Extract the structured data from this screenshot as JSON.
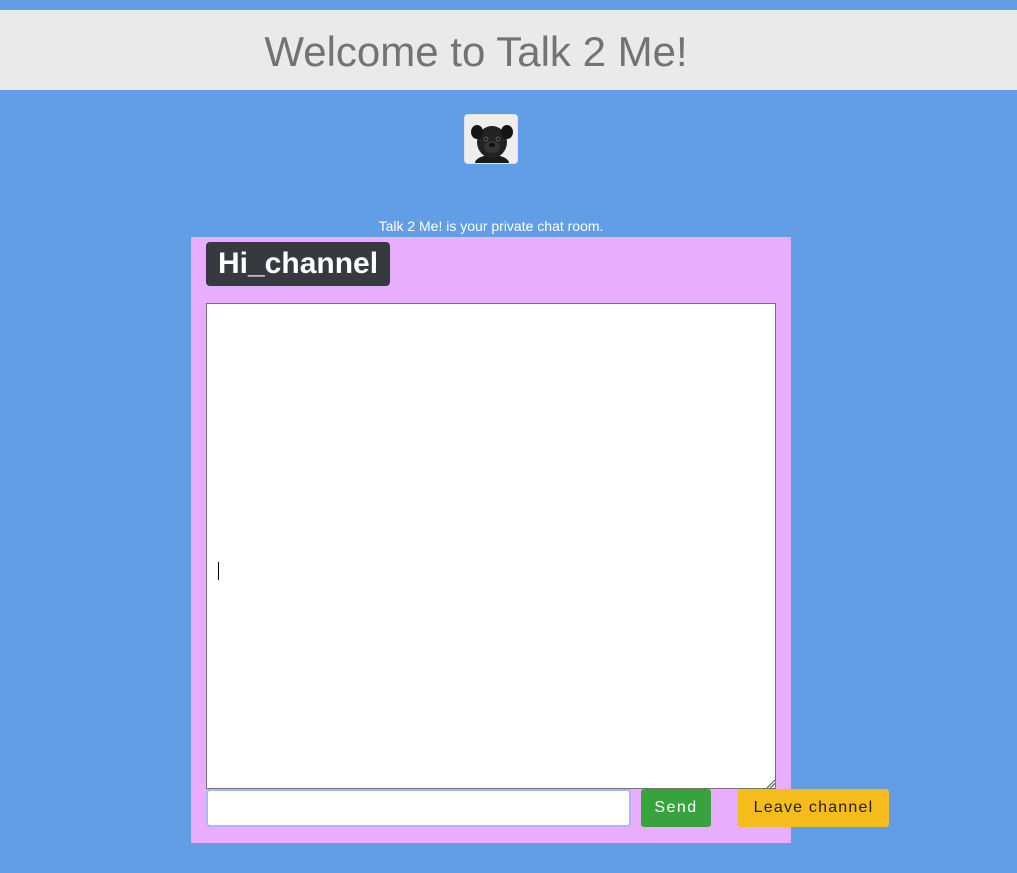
{
  "header": {
    "title": "Welcome to Talk 2 Me!"
  },
  "avatar": {
    "icon": "pug-dog-avatar"
  },
  "tagline": "Talk 2 Me! is your private chat room.",
  "chat": {
    "channel_name": "Hi_channel",
    "messages_text": "",
    "input_value": "",
    "send_label": "Send",
    "leave_label": "Leave channel"
  },
  "colors": {
    "background": "#629ee5",
    "header_bg": "#eaeaea",
    "panel_bg": "#e8adfd",
    "badge_bg": "#343a40",
    "send_bg": "#38a23c",
    "leave_bg": "#f6bc1c"
  }
}
